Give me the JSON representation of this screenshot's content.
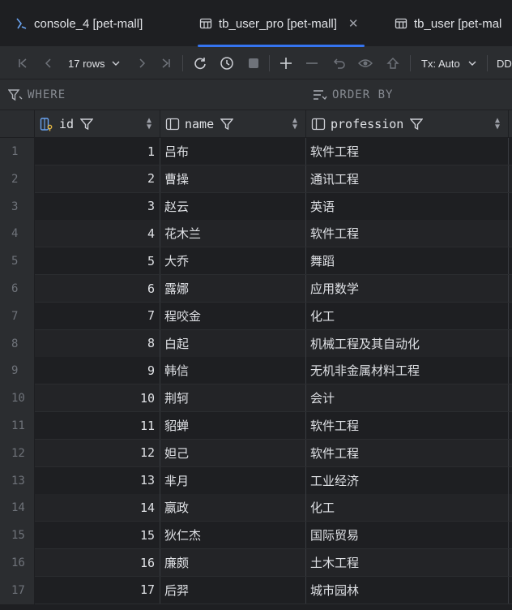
{
  "tabs": [
    {
      "label": "console_4 [pet-mall]",
      "icon": "console-icon",
      "active": false
    },
    {
      "label": "tb_user_pro [pet-mall]",
      "icon": "table-icon",
      "active": true
    },
    {
      "label": "tb_user [pet-mal",
      "icon": "table-icon",
      "active": false
    }
  ],
  "toolbar": {
    "rows_label": "17 rows",
    "tx_label": "Tx: Auto",
    "ddl_label": "DD"
  },
  "filter": {
    "where_label": "WHERE",
    "order_label": "ORDER BY"
  },
  "columns": [
    {
      "label": "id",
      "icon": "key-column-icon"
    },
    {
      "label": "name",
      "icon": "column-icon"
    },
    {
      "label": "profession",
      "icon": "column-icon"
    }
  ],
  "rows": [
    {
      "num": "1",
      "id": "1",
      "name": "吕布",
      "profession": "软件工程"
    },
    {
      "num": "2",
      "id": "2",
      "name": "曹操",
      "profession": "通讯工程"
    },
    {
      "num": "3",
      "id": "3",
      "name": "赵云",
      "profession": "英语"
    },
    {
      "num": "4",
      "id": "4",
      "name": "花木兰",
      "profession": "软件工程"
    },
    {
      "num": "5",
      "id": "5",
      "name": "大乔",
      "profession": "舞蹈"
    },
    {
      "num": "6",
      "id": "6",
      "name": "露娜",
      "profession": "应用数学"
    },
    {
      "num": "7",
      "id": "7",
      "name": "程咬金",
      "profession": "化工"
    },
    {
      "num": "8",
      "id": "8",
      "name": "白起",
      "profession": "机械工程及其自动化"
    },
    {
      "num": "9",
      "id": "9",
      "name": "韩信",
      "profession": "无机非金属材料工程"
    },
    {
      "num": "10",
      "id": "10",
      "name": "荆轲",
      "profession": "会计"
    },
    {
      "num": "11",
      "id": "11",
      "name": "貂蝉",
      "profession": "软件工程"
    },
    {
      "num": "12",
      "id": "12",
      "name": "妲己",
      "profession": "软件工程"
    },
    {
      "num": "13",
      "id": "13",
      "name": "芈月",
      "profession": "工业经济"
    },
    {
      "num": "14",
      "id": "14",
      "name": "嬴政",
      "profession": "化工"
    },
    {
      "num": "15",
      "id": "15",
      "name": "狄仁杰",
      "profession": "国际贸易"
    },
    {
      "num": "16",
      "id": "16",
      "name": "廉颇",
      "profession": "土木工程"
    },
    {
      "num": "17",
      "id": "17",
      "name": "后羿",
      "profession": "城市园林"
    }
  ],
  "colors": {
    "background": "#1e1f22",
    "panel": "#2b2d30",
    "accent": "#3574f0",
    "text": "#dfe1e5",
    "muted": "#6f737a"
  }
}
